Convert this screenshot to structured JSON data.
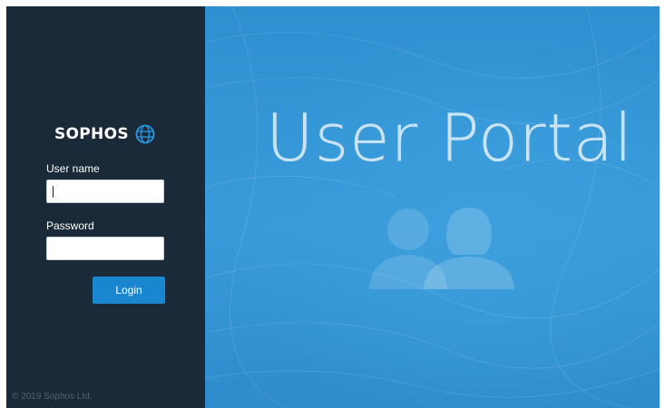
{
  "brand": {
    "name": "SOPHOS",
    "logo_icon": "globe-icon"
  },
  "login_form": {
    "username_label": "User name",
    "username_value": "",
    "password_label": "Password",
    "password_value": "",
    "login_button": "Login"
  },
  "footer": {
    "copyright": "© 2019 Sophos Ltd."
  },
  "hero": {
    "title": "User Portal",
    "illustration_icon": "users-icon"
  },
  "colors": {
    "sidebar_bg": "#1b2a38",
    "hero_bg": "#3a9bda",
    "button_bg": "#1a86d0",
    "text_light": "#ffffff"
  }
}
